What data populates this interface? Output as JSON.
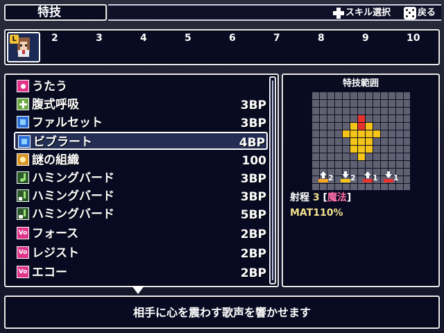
{
  "header": {
    "title": "特技",
    "skill_select_label": "スキル選択",
    "back_label": "戻る"
  },
  "party": {
    "leader_badge": "L",
    "slots": [
      "2",
      "3",
      "4",
      "5",
      "6",
      "7",
      "8",
      "9",
      "10"
    ]
  },
  "skills": [
    {
      "name": "うたう",
      "cost": "",
      "icon": "sing-icon"
    },
    {
      "name": "腹式呼吸",
      "cost": "3BP",
      "icon": "plus-icon"
    },
    {
      "name": "ファルセット",
      "cost": "3BP",
      "icon": "blue-square-icon"
    },
    {
      "name": "ビブラート",
      "cost": "4BP",
      "icon": "blue-square-icon"
    },
    {
      "name": "謎の組織",
      "cost": "100",
      "icon": "mystery-icon"
    },
    {
      "name": "ハミングバード",
      "cost": "3BP",
      "icon": "note-icon"
    },
    {
      "name": "ハミングバード",
      "cost": "3BP",
      "icon": "note-plus-icon"
    },
    {
      "name": "ハミングバード",
      "cost": "5BP",
      "icon": "note-plus2-icon"
    },
    {
      "name": "フォース",
      "cost": "2BP",
      "icon": "vo-icon"
    },
    {
      "name": "レジスト",
      "cost": "2BP",
      "icon": "vo-icon"
    },
    {
      "name": "エコー",
      "cost": "2BP",
      "icon": "vo-icon"
    }
  ],
  "selected_index": 3,
  "range_panel": {
    "title": "特技範囲",
    "modifiers": [
      "2",
      "2",
      "1",
      "1"
    ],
    "range_label": "射程",
    "range_value": "3",
    "range_type_open": "[",
    "range_type": "魔法",
    "range_type_close": "]",
    "mat_label": "MAT",
    "mat_value": "110%"
  },
  "description": "相手に心を震わす歌声を響かせます",
  "colors": {
    "window_bg": "#080a20",
    "border": "#e8e8f0",
    "accent_pink": "#ff6fa8",
    "accent_yellow": "#f2e08c",
    "range_red": "#e8322d",
    "range_yellow": "#f5c418"
  }
}
